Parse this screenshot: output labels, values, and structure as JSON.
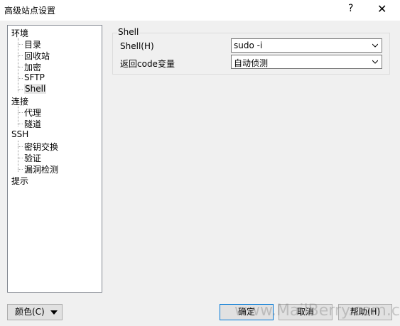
{
  "window": {
    "title": "高级站点设置",
    "help_label": "?",
    "close_label": "✕"
  },
  "tree": {
    "items": [
      {
        "label": "环境",
        "level": 0
      },
      {
        "label": "目录",
        "level": 1
      },
      {
        "label": "回收站",
        "level": 1
      },
      {
        "label": "加密",
        "level": 1
      },
      {
        "label": "SFTP",
        "level": 1
      },
      {
        "label": "Shell",
        "level": 1,
        "selected": true
      },
      {
        "label": "连接",
        "level": 0
      },
      {
        "label": "代理",
        "level": 1
      },
      {
        "label": "隧道",
        "level": 1
      },
      {
        "label": "SSH",
        "level": 0
      },
      {
        "label": "密钥交换",
        "level": 1
      },
      {
        "label": "验证",
        "level": 1
      },
      {
        "label": "漏洞检测",
        "level": 1
      },
      {
        "label": "提示",
        "level": 0
      }
    ]
  },
  "shell_group": {
    "title": "Shell",
    "shell_label": "Shell(H)",
    "shell_value": "sudo -i",
    "return_code_label": "返回code变量",
    "return_code_value": "自动侦测"
  },
  "buttons": {
    "color_label": "颜色(C)",
    "ok_label": "确定",
    "cancel_label": "取消",
    "help_label": "帮助(H)"
  },
  "watermark": "www.MailBerry.com.cn",
  "icons": {
    "dropdown": "chevron-down-icon",
    "close": "close-icon"
  }
}
